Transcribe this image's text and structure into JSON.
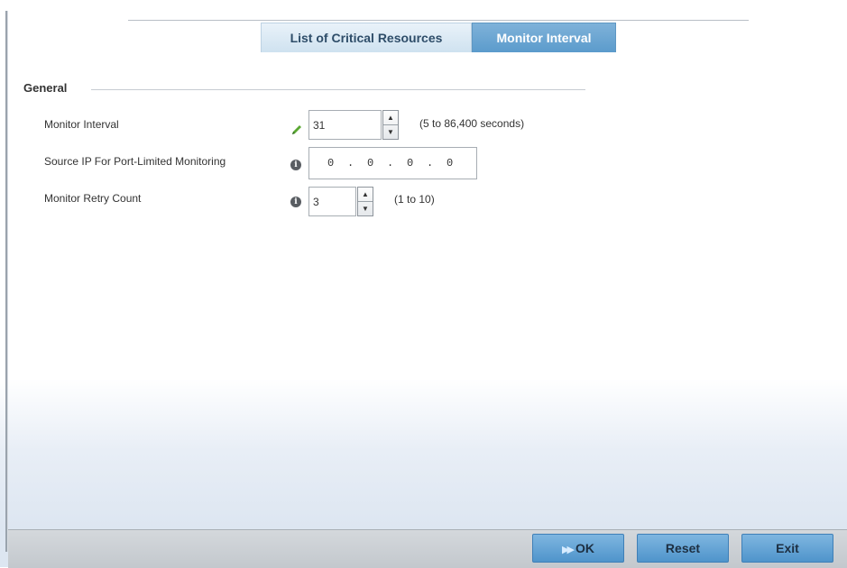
{
  "tabs": [
    {
      "label": "List of Critical Resources",
      "active": false
    },
    {
      "label": "Monitor Interval",
      "active": true
    }
  ],
  "group": {
    "title": "General"
  },
  "fields": {
    "monitor_interval": {
      "label": "Monitor Interval",
      "value": "31",
      "range": "(5 to 86,400 seconds)",
      "icon": "pencil-icon"
    },
    "source_ip": {
      "label": "Source IP For Port-Limited Monitoring",
      "octets": [
        "0",
        "0",
        "0",
        "0"
      ],
      "icon": "info-icon"
    },
    "retry_count": {
      "label": "Monitor Retry Count",
      "value": "3",
      "range": "(1 to 10)",
      "icon": "info-icon"
    }
  },
  "buttons": {
    "ok": "OK",
    "reset": "Reset",
    "exit": "Exit"
  },
  "colors": {
    "active_tab": "#5b9bcc",
    "inactive_tab": "#cfe2f0",
    "button": "#4f94cb"
  }
}
